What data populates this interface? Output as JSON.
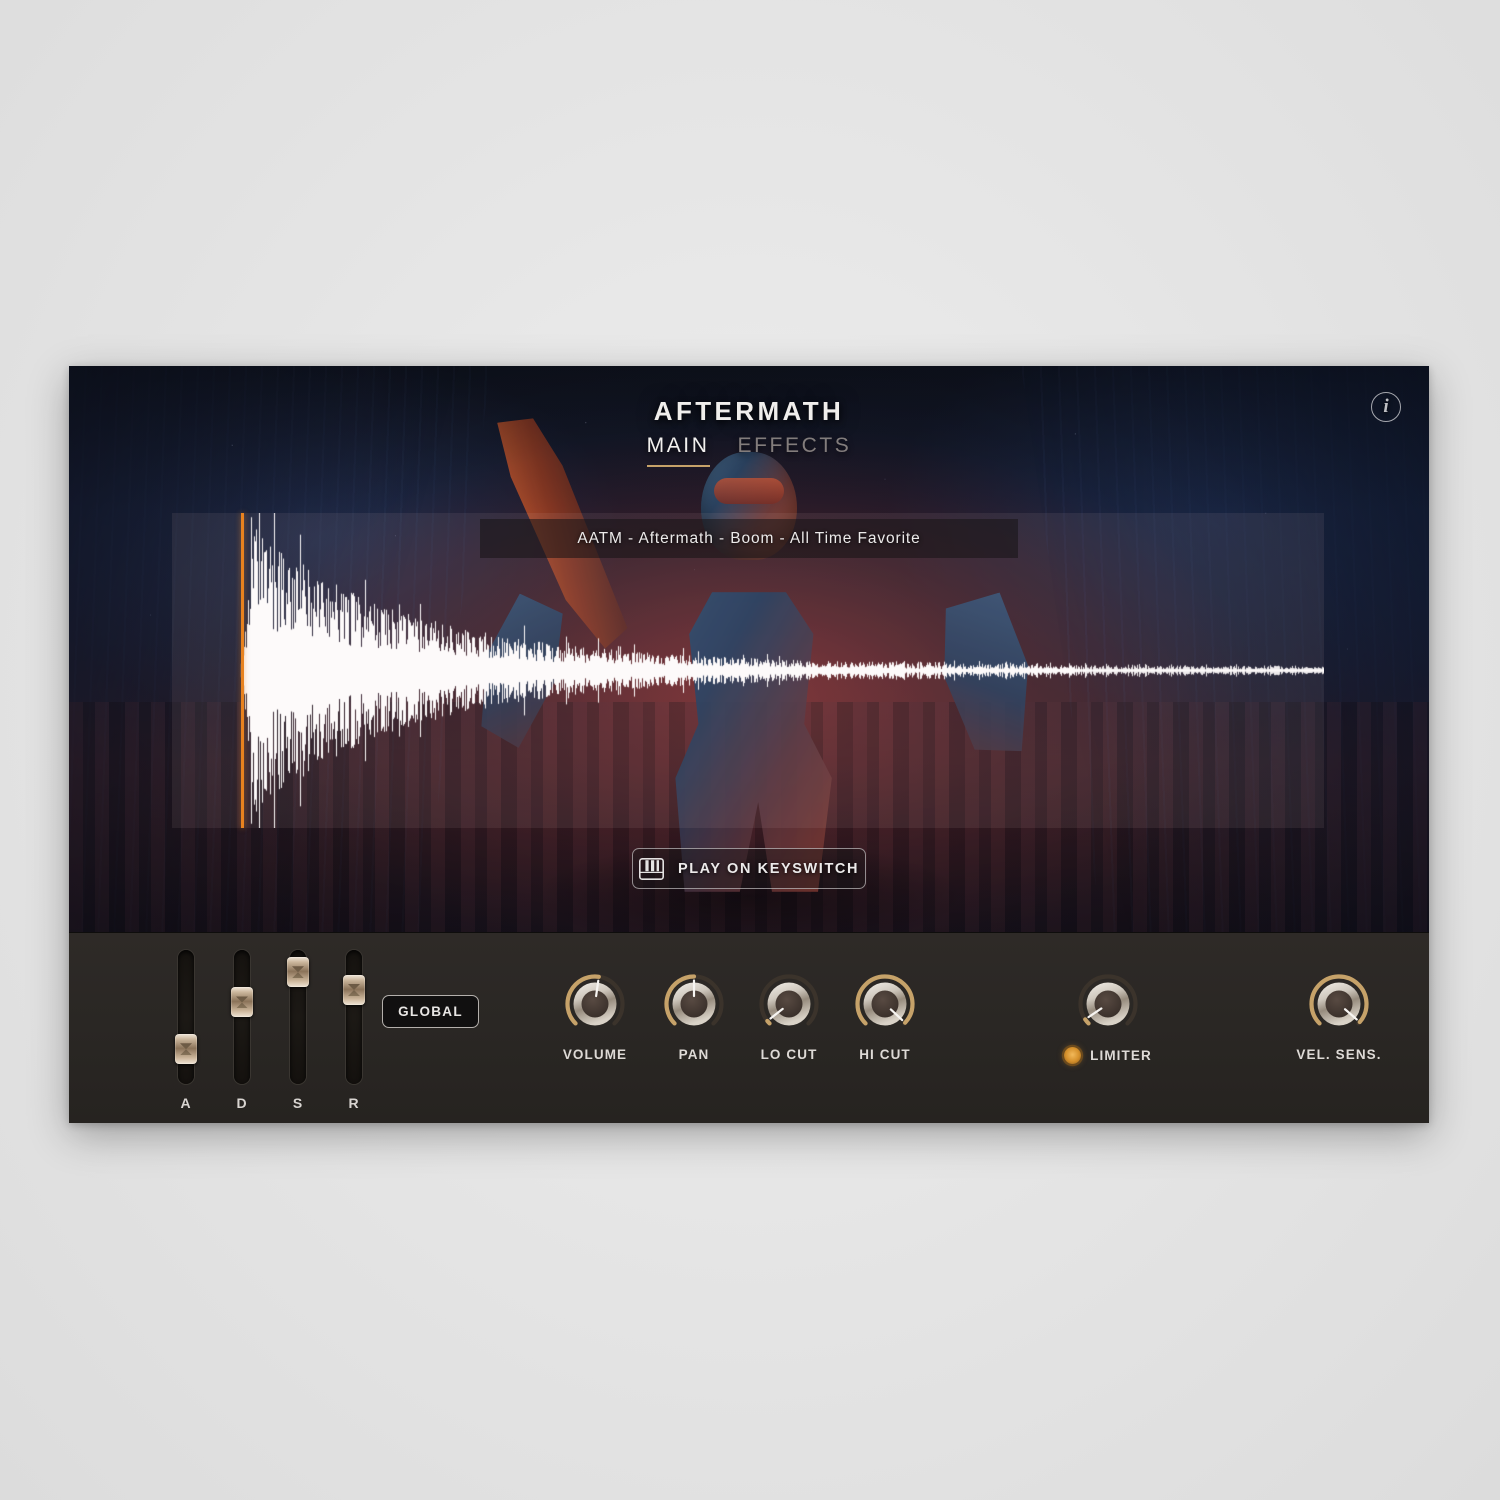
{
  "app": {
    "title": "AFTERMATH",
    "info_icon": "info-icon"
  },
  "tabs": [
    {
      "label": "MAIN",
      "active": true
    },
    {
      "label": "EFFECTS",
      "active": false
    }
  ],
  "preset": {
    "name": "AATM - Aftermath - Boom - All Time Favorite"
  },
  "waveform": {
    "playhead_position_pct": 6,
    "selection_start_pct": 0,
    "selection_end_pct": 100,
    "accent_color": "#e8821f",
    "wave_color": "#ffffff"
  },
  "keyswitch": {
    "label": "PLAY ON KEYSWITCH",
    "icon": "piano-keys-icon"
  },
  "envelope": {
    "sliders": [
      {
        "label": "A",
        "value_pct": 19
      },
      {
        "label": "D",
        "value_pct": 64
      },
      {
        "label": "S",
        "value_pct": 93
      },
      {
        "label": "R",
        "value_pct": 76
      }
    ],
    "global_button_label": "GLOBAL"
  },
  "knobs": [
    {
      "label": "VOLUME",
      "angle_deg": 8,
      "arc_from_deg": -135,
      "arc_to_deg": 8,
      "has_led": false,
      "led_on": false
    },
    {
      "label": "PAN",
      "angle_deg": 0,
      "arc_from_deg": -135,
      "arc_to_deg": 0,
      "has_led": false,
      "led_on": false
    },
    {
      "label": "LO CUT",
      "angle_deg": -128,
      "arc_from_deg": -135,
      "arc_to_deg": -128,
      "has_led": false,
      "led_on": false
    },
    {
      "label": "HI CUT",
      "angle_deg": 133,
      "arc_from_deg": -135,
      "arc_to_deg": 133,
      "has_led": false,
      "led_on": false
    },
    {
      "label": "LIMITER",
      "angle_deg": -124,
      "arc_from_deg": -135,
      "arc_to_deg": -124,
      "has_led": true,
      "led_on": true
    },
    {
      "label": "VEL. SENS.",
      "angle_deg": 131,
      "arc_from_deg": -135,
      "arc_to_deg": 131,
      "has_led": false,
      "led_on": false
    }
  ],
  "colors": {
    "accent_gold": "#c6a269",
    "accent_orange": "#e8821f",
    "panel_bg": "#2a2724",
    "text_primary": "#eceaea"
  }
}
